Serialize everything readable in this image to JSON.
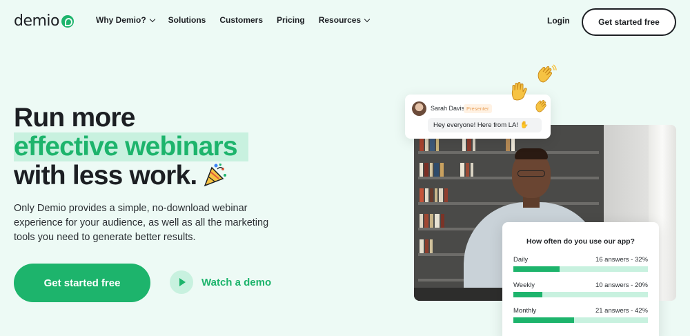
{
  "brand": {
    "logo_text": "demio",
    "accent": "#1db46c",
    "accent_light": "#c8f1df",
    "background": "#edfaf5",
    "text": "#1c1f23"
  },
  "nav": {
    "items": [
      {
        "label": "Why Demio?",
        "dropdown": true
      },
      {
        "label": "Solutions",
        "dropdown": false
      },
      {
        "label": "Customers",
        "dropdown": false
      },
      {
        "label": "Pricing",
        "dropdown": false
      },
      {
        "label": "Resources",
        "dropdown": true
      }
    ],
    "login_label": "Login",
    "cta_label": "Get started free"
  },
  "hero": {
    "headline_line1": "Run more",
    "headline_line2": "effective webinars",
    "headline_line3": "with less work.",
    "subcopy": "Only Demio provides a simple, no-download webinar experience for your audience, as well as all the marketing tools you need to generate better results.",
    "cta_label": "Get started free",
    "watch_label": "Watch a demo"
  },
  "chat": {
    "name": "Sarah Davis",
    "badge": "Presenter",
    "message": "Hey everyone! Here from LA!"
  },
  "poll": {
    "question": "How often do you use our app?",
    "options": [
      {
        "label": "Daily",
        "stat": "16 answers - 32%",
        "fraction": 0.32
      },
      {
        "label": "Weekly",
        "stat": "10 answers - 20%",
        "fraction": 0.2
      },
      {
        "label": "Monthly",
        "stat": "21 answers - 42%",
        "fraction": 0.42
      }
    ]
  },
  "icons": [
    "logo-mark-icon",
    "chevron-down-icon",
    "party-popper-icon",
    "play-icon",
    "waving-hand-icon",
    "raised-hand-icon"
  ]
}
